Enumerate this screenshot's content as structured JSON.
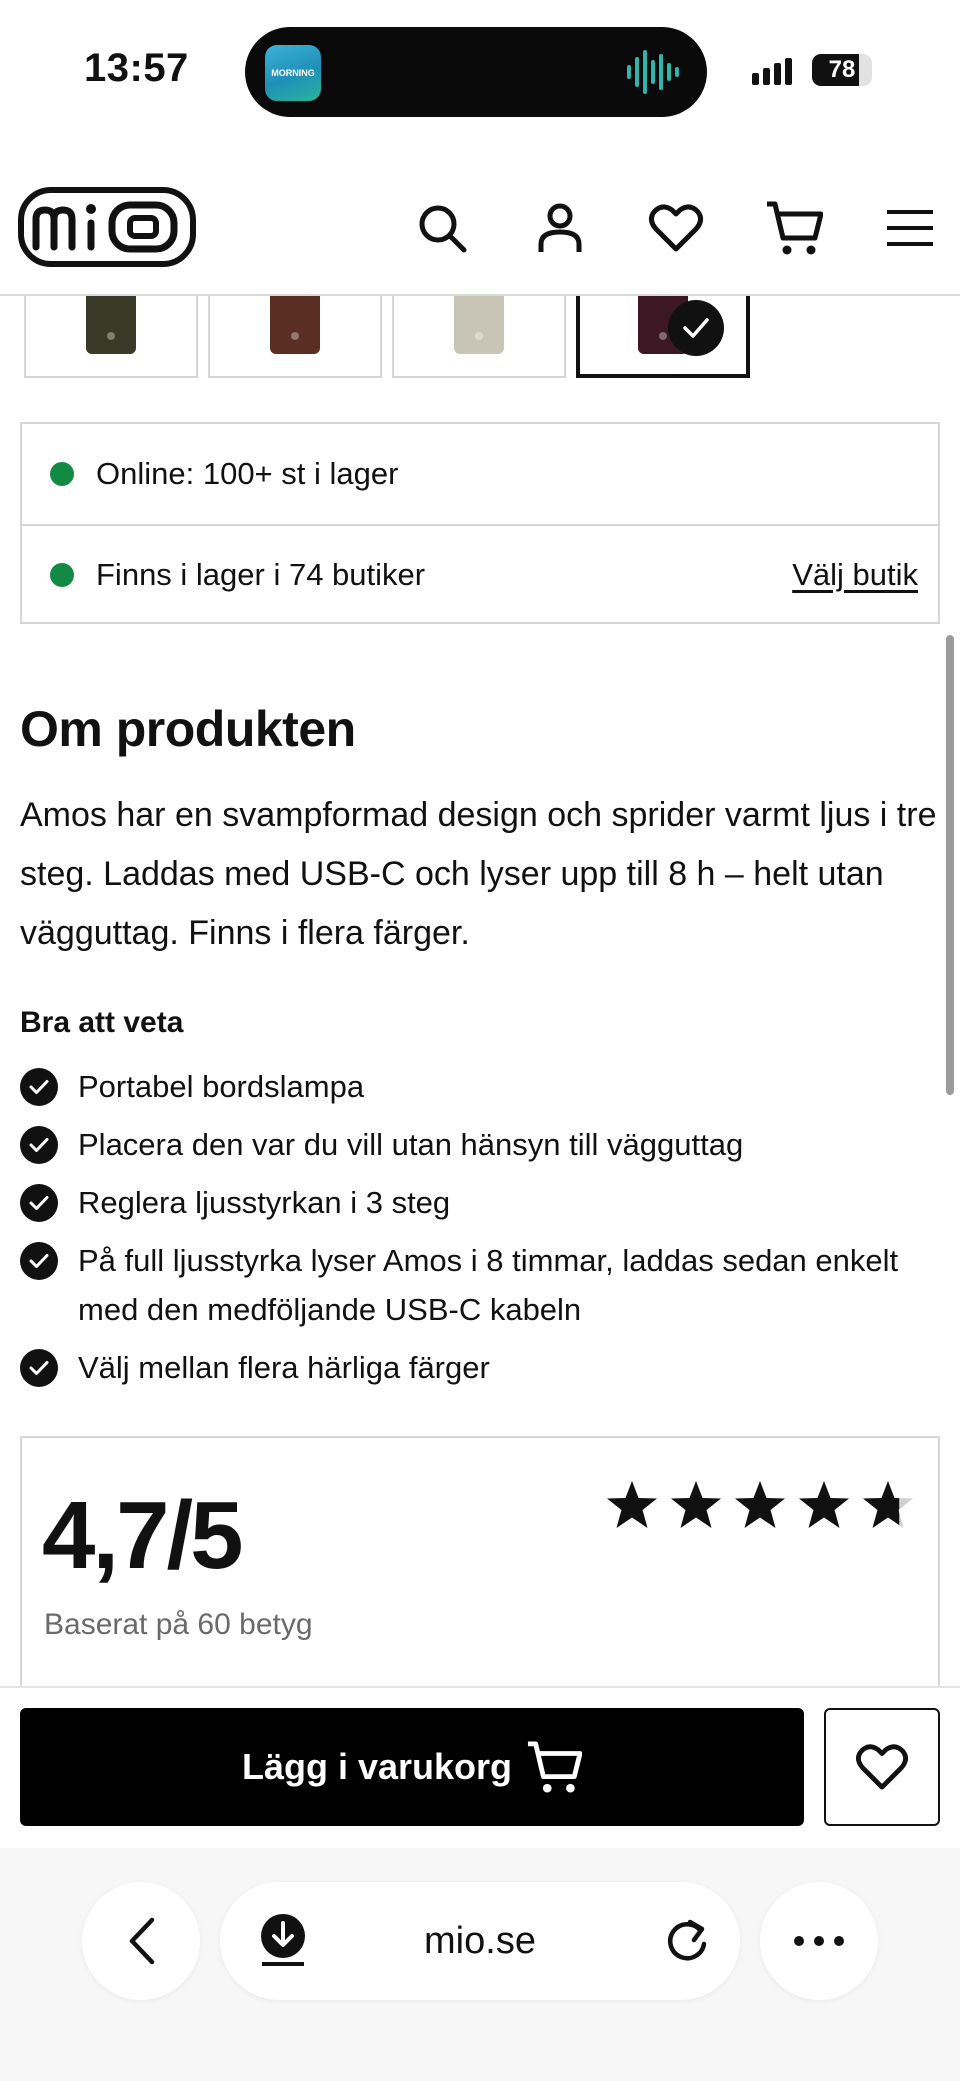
{
  "status_bar": {
    "time": "13:57",
    "island_app_label": "MORNING",
    "battery": "78",
    "battery_level": 0.78
  },
  "header": {
    "logo_text": "mio",
    "icons": [
      "search-icon",
      "user-icon",
      "heart-icon",
      "cart-icon",
      "menu-icon"
    ]
  },
  "thumbnails": [
    {
      "color": "#3a3a28",
      "selected": false
    },
    {
      "color": "#5a2e22",
      "selected": false
    },
    {
      "color": "#c9c5b6",
      "selected": false
    },
    {
      "color": "#3d1724",
      "selected": true
    }
  ],
  "stock": {
    "online": "Online: 100+ st i lager",
    "stores": "Finns i lager i 74 butiker",
    "choose_store": "Välj butik",
    "status_color": "#128a43"
  },
  "about": {
    "title": "Om produkten",
    "text": "Amos har en svampformad design och sprider varmt ljus i tre steg. Laddas med USB-C och lyser upp till 8 h – helt utan vägguttag. Finns i flera färger.",
    "good_to_know_title": "Bra att veta",
    "features": [
      "Portabel bordslampa",
      "Placera den var du vill utan hänsyn till vägguttag",
      "Reglera ljusstyrkan i 3 steg",
      "På full ljusstyrka lyser Amos i 8 timmar, laddas sedan enkelt med den medföljande USB-C kabeln",
      "Välj mellan flera härliga färger"
    ]
  },
  "rating": {
    "score": "4,7/5",
    "basis": "Baserat på 60 betyg",
    "stars_value": 4.7,
    "stars_max": 5
  },
  "cart": {
    "add_label": "Lägg i varukorg"
  },
  "browser": {
    "url": "mio.se"
  }
}
